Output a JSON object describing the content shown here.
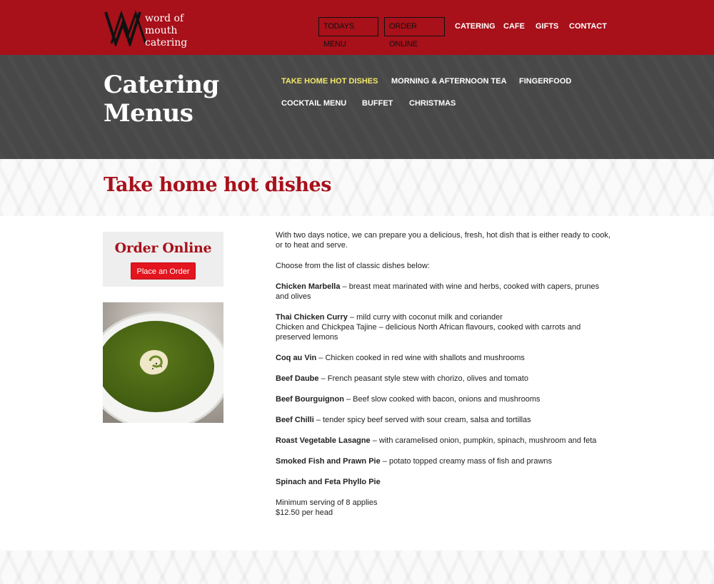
{
  "brand": {
    "logo_mark": "WM",
    "line1": "word of mouth",
    "line2": "catering"
  },
  "topnav": {
    "todays_menu": "TODAYS MENU",
    "order_online": "ORDER ONLINE",
    "catering": "CATERING",
    "cafe": "CAFE",
    "gifts": "GIFTS",
    "contact": "CONTACT"
  },
  "band": {
    "title_line1": "Catering",
    "title_line2": "Menus",
    "subnav": [
      "TAKE HOME HOT DISHES",
      "MORNING & AFTERNOON TEA",
      "FINGERFOOD",
      "COCKTAIL MENU",
      "BUFFET",
      "CHRISTMAS"
    ]
  },
  "page": {
    "heading": "Take home hot dishes"
  },
  "sidebar": {
    "order_title": "Order Online",
    "order_button": "Place an Order"
  },
  "content": {
    "intro": "With two days notice, we can prepare you a delicious, fresh, hot dish that is either ready to cook, or to heat and serve.",
    "choose": "Choose from the list of classic dishes below:",
    "dishes": [
      {
        "name": "Chicken Marbella",
        "desc": " – breast meat marinated with wine and herbs, cooked with capers, prunes and olives"
      },
      {
        "name": "Thai Chicken Curry",
        "desc": " – mild curry with coconut milk and coriander",
        "extra": "Chicken and Chickpea Tajine – delicious North African flavours, cooked with carrots and preserved lemons"
      },
      {
        "name": "Coq au Vin",
        "desc": " – Chicken cooked in red wine with shallots and mushrooms"
      },
      {
        "name": "Beef Daube",
        "desc": " – French peasant style stew with chorizo, olives and tomato"
      },
      {
        "name": "Beef Bourguignon",
        "desc": " – Beef slow cooked with bacon, onions and mushrooms"
      },
      {
        "name": "Beef Chilli",
        "desc": " – tender spicy beef served with sour cream, salsa and tortillas"
      },
      {
        "name": "Roast Vegetable Lasagne",
        "desc": " – with caramelised onion, pumpkin, spinach, mushroom and feta"
      },
      {
        "name": "Smoked Fish and Prawn Pie",
        "desc": " – potato topped creamy mass of fish and prawns"
      },
      {
        "name": "Spinach and Feta Phyllo Pie",
        "desc": ""
      }
    ],
    "min_serving": "Minimum serving of 8 applies",
    "price": "$12.50 per head"
  },
  "colors": {
    "brand_red": "#a8101a",
    "button_red": "#e3151e",
    "band_grey": "#484848",
    "active_yellow": "#f3e86a"
  }
}
